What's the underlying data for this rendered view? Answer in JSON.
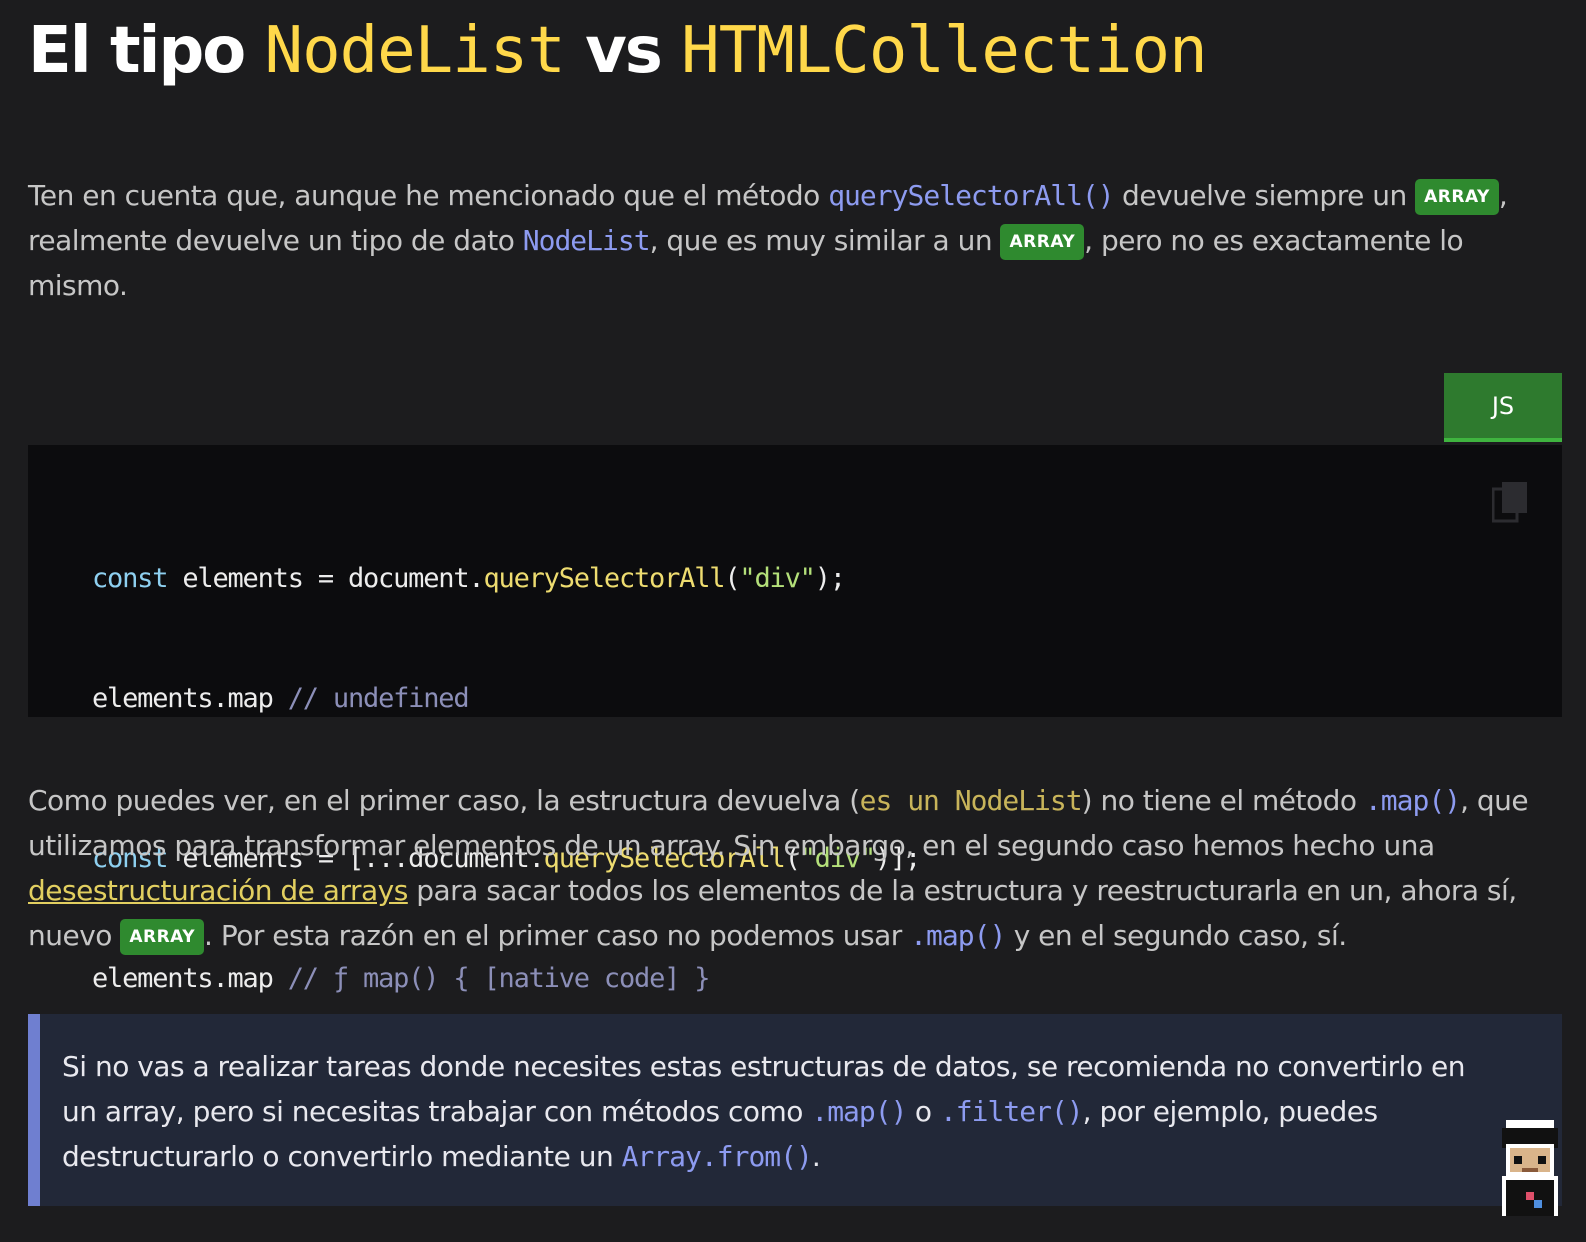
{
  "heading": {
    "prefix": "El tipo",
    "code1": "NodeList",
    "middle": "vs",
    "code2": "HTMLCollection"
  },
  "paragraph1": {
    "t1": "Ten en cuenta que, aunque he mencionado que el método ",
    "code1": "querySelectorAll()",
    "t2": " devuelve siempre un ",
    "badge1": "ARRAY",
    "t3": ", realmente devuelve un tipo de dato ",
    "code2": "NodeList",
    "t4": ", que es muy similar a un ",
    "badge2": "ARRAY",
    "t5": ", pero no es exactamente lo mismo."
  },
  "code_block": {
    "language_tab": "JS",
    "lines": [
      {
        "kw": "const",
        "a": " elements = document.",
        "fn": "querySelectorAll",
        "b": "(",
        "str": "\"div\"",
        "c": ");",
        "cm": ""
      },
      {
        "kw": "",
        "a": "elements.map ",
        "fn": "",
        "b": "",
        "str": "",
        "c": "",
        "cm": "// undefined"
      },
      {
        "kw": "const",
        "a": " elements = [...document.",
        "fn": "querySelectorAll",
        "b": "(",
        "str": "\"div\"",
        "c": ")];",
        "cm": ""
      },
      {
        "kw": "",
        "a": "elements.map ",
        "fn": "",
        "b": "",
        "str": "",
        "c": "",
        "cm": "// ƒ map() { [native code] }"
      }
    ]
  },
  "paragraph2": {
    "t1": "Como puedes ver, en el primer caso, la estructura devuelva (",
    "code1": "es un NodeList",
    "t2": ") no tiene el método ",
    "code2": ".map()",
    "t3": ", que utilizamos para transformar elementos de un array. Sin embargo, en el segundo caso hemos hecho una ",
    "link": "desestructuración de arrays",
    "t4": " para sacar todos los elementos de la estructura y reestructurarla en un, ahora sí, nuevo ",
    "badge": "ARRAY",
    "t5": ". Por esta razón en el primer caso no podemos usar ",
    "code3": ".map()",
    "t6": " y en el segundo caso, sí."
  },
  "note": {
    "t1": "Si no vas a realizar tareas donde necesites estas estructuras de datos, se recomienda no convertirlo en un array, pero si necesitas trabajar con métodos como ",
    "code1": ".map()",
    "t2": " o ",
    "code2": ".filter()",
    "t3": ", por ejemplo, puedes destructurarlo o convertirlo mediante un ",
    "code3": "Array.from()",
    "t4": "."
  },
  "colors": {
    "background": "#1c1c1e",
    "badge": "#2f8a2f",
    "inline_code": "#8d9bf0",
    "heading_code": "#ffd84a",
    "link": "#e2cf60",
    "note_border": "#6f7fd0"
  },
  "icons": [
    "copy-icon",
    "pixel-avatar"
  ]
}
